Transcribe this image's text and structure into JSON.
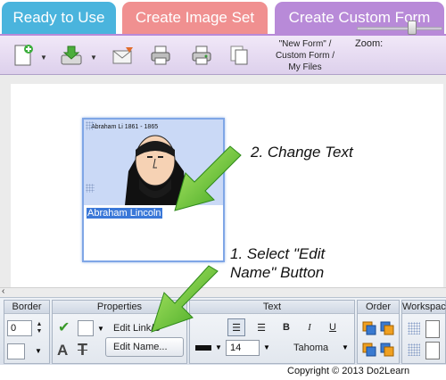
{
  "tabs": [
    {
      "label": "Ready to Use",
      "color": "#4ab4dd"
    },
    {
      "label": "Create Image Set",
      "color": "#f09090"
    },
    {
      "label": "Create Custom Form",
      "color": "#b88ad8"
    }
  ],
  "toolbar": {
    "breadcrumb": [
      "\"New Form\" /",
      "Custom Form /",
      "My Files"
    ],
    "zoom_label": "Zoom:",
    "zoom_level": 0.65,
    "icons": [
      "new-form-icon",
      "save-icon",
      "email-icon",
      "print-icon",
      "print-preview-icon",
      "copy-icon"
    ]
  },
  "card": {
    "caption": "Abraham Li      1861 - 1865",
    "name_text": "Abraham Lincoln"
  },
  "annotations": {
    "step2": "2. Change Text",
    "step1_line1": "1. Select \"Edit",
    "step1_line2": "Name\" Button"
  },
  "panels": {
    "border": {
      "title": "Border",
      "value": "0"
    },
    "properties": {
      "title": "Properties",
      "edit_link": "Edit Link/U",
      "edit_name": "Edit Name..."
    },
    "text": {
      "title": "Text",
      "font_size": "14",
      "font_name": "Tahoma"
    },
    "order": {
      "title": "Order"
    },
    "workspace": {
      "title": "Workspac"
    }
  },
  "copyright": "Copyright © 2013 Do2Learn"
}
